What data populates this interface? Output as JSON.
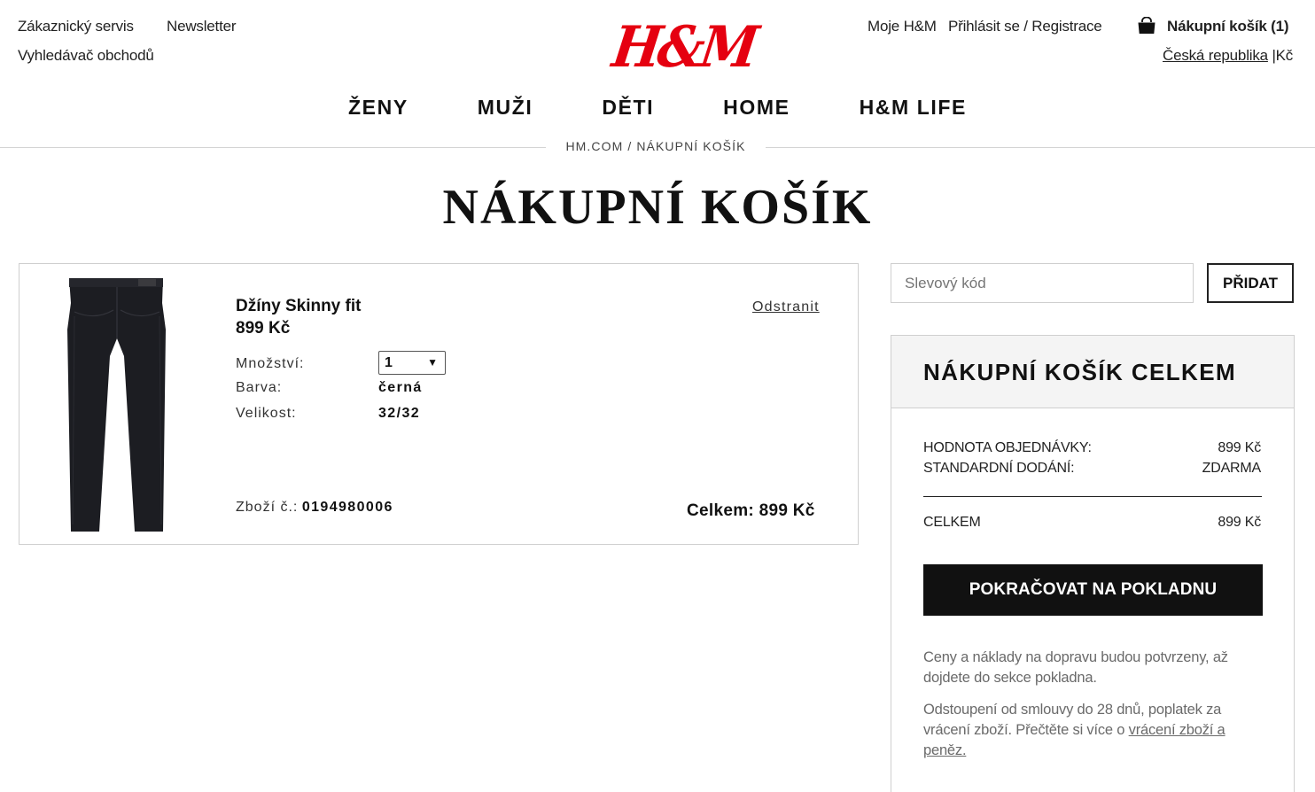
{
  "header": {
    "left_links": [
      "Zákaznický servis",
      "Newsletter",
      "Vyhledávač obchodů"
    ],
    "logo": "H&M",
    "my_hm": "Moje H&M",
    "login": "Přihlásit se / Registrace",
    "cart_label": "Nákupní košík (1)",
    "country": "Česká republika",
    "separator": "|",
    "currency": "Kč"
  },
  "nav": {
    "items": [
      "ŽENY",
      "MUŽI",
      "DĚTI",
      "HOME",
      "H&M LIFE"
    ]
  },
  "breadcrumb": "HM.COM / NÁKUPNÍ KOŠÍK",
  "page_title": "NÁKUPNÍ KOŠÍK",
  "cart_item": {
    "name": "Džíny Skinny fit",
    "price": "899 Kč",
    "remove_label": "Odstranit",
    "quantity_label": "Množství:",
    "quantity_value": "1",
    "color_label": "Barva:",
    "color_value": "černá",
    "size_label": "Velikost:",
    "size_value": "32/32",
    "article_label": "Zboží č.:",
    "article_number": "0194980006",
    "total": "Celkem: 899 Kč"
  },
  "discount": {
    "placeholder": "Slevový kód",
    "button": "PŘIDAT"
  },
  "summary": {
    "title": "NÁKUPNÍ KOŠÍK CELKEM",
    "order_value_label": "HODNOTA OBJEDNÁVKY:",
    "order_value": "899 Kč",
    "shipping_label": "STANDARDNÍ DODÁNÍ:",
    "shipping_value": "ZDARMA",
    "total_label": "CELKEM",
    "total_value": "899 Kč",
    "checkout_button": "POKRAČOVAT NA POKLADNU",
    "note_1": "Ceny a náklady na dopravu budou potvrzeny, až dojdete do sekce pokladna.",
    "note_2_text": "Odstoupení od smlouvy do 28 dnů, poplatek za vrácení zboží. Přečtěte si více o ",
    "note_2_link": "vrácení zboží a peněz."
  },
  "colors": {
    "brand_red": "#e50010",
    "checkout_black": "#111111",
    "summary_header_bg": "#f4f4f4"
  }
}
